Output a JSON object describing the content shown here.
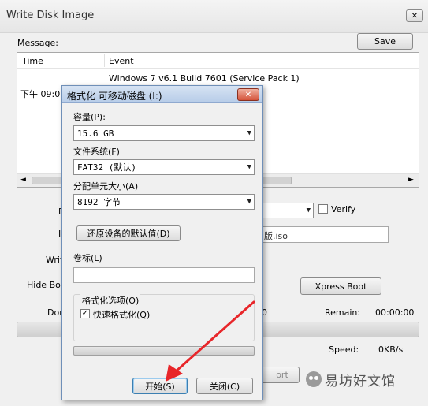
{
  "main_window": {
    "title": "Write Disk Image",
    "close_glyph": "✕",
    "message_label": "Message:",
    "save_label": "Save",
    "log_headers": {
      "time": "Time",
      "event": "Event"
    },
    "log_rows": [
      {
        "time": "下午 09:0",
        "event": "Windows 7 v6.1 Build 7601 (Service Pack 1)"
      }
    ],
    "labels": {
      "disk_drive": "D",
      "image_file": "I",
      "write_method": "Write",
      "hide_boot": "Hide Boo",
      "done": "Dor",
      "elapsed_tail": "0",
      "remain": "Remain:",
      "remain_value": "00:00:00",
      "speed": "Speed:",
      "speed_value": "0KB/s"
    },
    "verify_label": "Verify",
    "image_path_tail": "版.iso",
    "xpress_boot_label": "Xpress Boot",
    "abort_partial": "ort"
  },
  "format_dialog": {
    "title": "格式化 可移动磁盘 (I:)",
    "close_glyph": "✕",
    "capacity_label": "容量(P):",
    "capacity_value": "15.6 GB",
    "filesystem_label": "文件系统(F)",
    "filesystem_value": "FAT32 (默认)",
    "cluster_label": "分配单元大小(A)",
    "cluster_value": "8192 字节",
    "restore_defaults_label": "还原设备的默认值(D)",
    "volume_label": "卷标(L)",
    "volume_value": "",
    "options_group_label": "格式化选项(O)",
    "quick_format_label": "快速格式化(Q)",
    "quick_format_checked": "✓",
    "start_label": "开始(S)",
    "close_label": "关闭(C)"
  },
  "watermark": {
    "text": "易坊好文馆"
  },
  "colors": {
    "arrow": "#e8262a",
    "dialog_title_bg": "#bcd1ea",
    "window_bg": "#f0f0f0"
  }
}
